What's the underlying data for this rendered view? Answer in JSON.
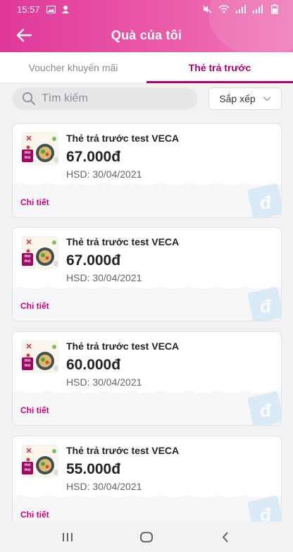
{
  "status_bar": {
    "time": "15:57"
  },
  "header": {
    "title": "Quà của tôi"
  },
  "tabs": [
    {
      "label": "Voucher khuyến mãi",
      "active": false
    },
    {
      "label": "Thẻ trả trước",
      "active": true
    }
  ],
  "search": {
    "placeholder": "Tìm kiếm",
    "value": ""
  },
  "sort": {
    "label": "Sắp xếp"
  },
  "cards": [
    {
      "title": "Thẻ trả trước test VECA",
      "price": "67.000đ",
      "expiry": "HSD: 30/04/2021",
      "detail_label": "Chi tiết",
      "logo_text_1": "mo",
      "logo_text_2": "mo"
    },
    {
      "title": "Thẻ trả trước test VECA",
      "price": "67.000đ",
      "expiry": "HSD: 30/04/2021",
      "detail_label": "Chi tiết",
      "logo_text_1": "mo",
      "logo_text_2": "mo"
    },
    {
      "title": "Thẻ trả trước test VECA",
      "price": "60.000đ",
      "expiry": "HSD: 30/04/2021",
      "detail_label": "Chi tiết",
      "logo_text_1": "mo",
      "logo_text_2": "mo"
    },
    {
      "title": "Thẻ trả trước test VECA",
      "price": "55.000đ",
      "expiry": "HSD: 30/04/2021",
      "detail_label": "Chi tiết",
      "logo_text_1": "mo",
      "logo_text_2": "mo"
    }
  ],
  "colors": {
    "header_start": "#e0379a",
    "header_end": "#f07cbb",
    "accent": "#b0006d",
    "detail": "#c4007a",
    "momo": "#a50064"
  }
}
